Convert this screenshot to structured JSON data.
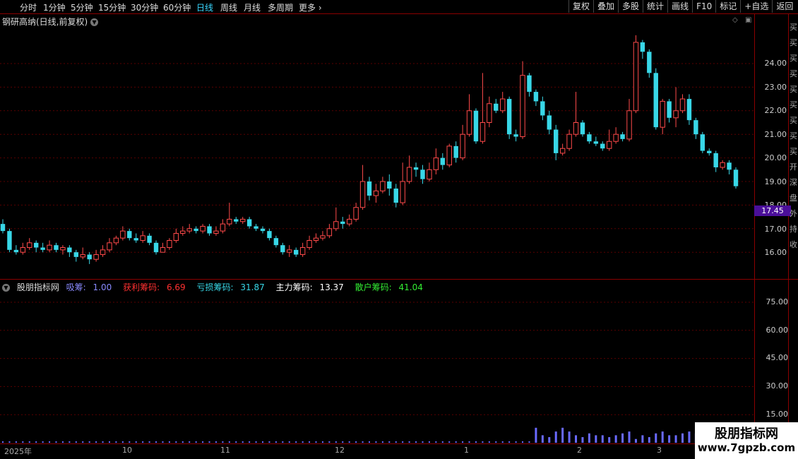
{
  "toolbar": {
    "periods": [
      "分时",
      "1分钟",
      "5分钟",
      "15分钟",
      "30分钟",
      "60分钟",
      "日线",
      "周线",
      "月线",
      "多周期",
      "更多"
    ],
    "active_period": "日线",
    "right_buttons": [
      "复权",
      "叠加",
      "多股",
      "统计",
      "画线",
      "F10",
      "标记",
      "+自选",
      "返回"
    ]
  },
  "main_chart": {
    "title": "钢研高纳(日线,前复权)",
    "price_labels": [
      "24.00",
      "23.00",
      "22.00",
      "21.00",
      "20.00",
      "19.00",
      "18.00",
      "17.00",
      "16.00"
    ],
    "current_price": "17.45",
    "colors": {
      "up": "#ff4a4a",
      "down": "#38d7e7",
      "grid": "#5a0000",
      "current_bg": "#4b0f9a"
    }
  },
  "right_strip_chars": [
    "买",
    "买",
    "买",
    "买",
    "买",
    "买",
    "买",
    "买",
    "买",
    "开",
    "深",
    "盘",
    "外",
    "持",
    "收"
  ],
  "indicator": {
    "name": "股朋指标网",
    "values": [
      {
        "label": "吸筹:",
        "value": "1.00",
        "color": "#8a8aff"
      },
      {
        "label": "获利筹码:",
        "value": "6.69",
        "color": "#ff3030"
      },
      {
        "label": "亏损筹码:",
        "value": "31.87",
        "color": "#38d7e7"
      },
      {
        "label": "主力筹码:",
        "value": "13.37",
        "color": "#ffffff"
      },
      {
        "label": "散户筹码:",
        "value": "41.04",
        "color": "#33ee33"
      }
    ],
    "axis_labels": [
      "75.00",
      "60.00",
      "45.00",
      "30.00",
      "15.00"
    ]
  },
  "xaxis": [
    "2025年",
    "10",
    "11",
    "12",
    "1",
    "2",
    "3"
  ],
  "chart_data": [
    {
      "type": "candlestick",
      "title": "钢研高纳(日线,前复权)",
      "ylim": [
        15.0,
        25.5
      ],
      "candles": [
        [
          17.2,
          16.9,
          17.4,
          16.8
        ],
        [
          16.9,
          16.1,
          17.0,
          16.0
        ],
        [
          16.1,
          16.0,
          16.3,
          15.9
        ],
        [
          16.0,
          16.2,
          16.4,
          15.9
        ],
        [
          16.2,
          16.4,
          16.6,
          16.1
        ],
        [
          16.4,
          16.2,
          16.5,
          16.0
        ],
        [
          16.2,
          16.1,
          16.4,
          16.0
        ],
        [
          16.1,
          16.3,
          16.5,
          16.0
        ],
        [
          16.3,
          16.1,
          16.4,
          16.0
        ],
        [
          16.1,
          16.2,
          16.3,
          15.9
        ],
        [
          16.2,
          16.0,
          16.3,
          15.8
        ],
        [
          16.0,
          15.8,
          16.1,
          15.6
        ],
        [
          15.8,
          15.9,
          16.2,
          15.7
        ],
        [
          15.9,
          15.7,
          16.0,
          15.5
        ],
        [
          15.7,
          15.9,
          16.1,
          15.6
        ],
        [
          15.9,
          16.1,
          16.3,
          15.8
        ],
        [
          16.1,
          16.4,
          16.6,
          16.0
        ],
        [
          16.4,
          16.6,
          16.7,
          16.3
        ],
        [
          16.6,
          16.9,
          17.1,
          16.5
        ],
        [
          16.9,
          16.6,
          17.0,
          16.5
        ],
        [
          16.6,
          16.5,
          16.8,
          16.4
        ],
        [
          16.5,
          16.7,
          16.9,
          16.4
        ],
        [
          16.7,
          16.4,
          16.8,
          16.3
        ],
        [
          16.4,
          16.0,
          16.5,
          15.9
        ],
        [
          16.0,
          16.2,
          16.4,
          16.0
        ],
        [
          16.2,
          16.5,
          16.6,
          16.1
        ],
        [
          16.5,
          16.8,
          17.0,
          16.4
        ],
        [
          16.8,
          16.9,
          17.1,
          16.7
        ],
        [
          16.9,
          17.0,
          17.2,
          16.8
        ],
        [
          17.0,
          16.9,
          17.1,
          16.8
        ],
        [
          16.9,
          17.1,
          17.2,
          16.8
        ],
        [
          17.1,
          16.8,
          17.2,
          16.7
        ],
        [
          16.8,
          16.9,
          17.1,
          16.7
        ],
        [
          16.9,
          17.2,
          17.4,
          16.8
        ],
        [
          17.2,
          17.4,
          18.1,
          17.1
        ],
        [
          17.4,
          17.3,
          17.5,
          17.2
        ],
        [
          17.3,
          17.4,
          17.5,
          17.2
        ],
        [
          17.4,
          17.1,
          17.5,
          17.0
        ],
        [
          17.1,
          17.0,
          17.2,
          16.9
        ],
        [
          17.0,
          16.9,
          17.1,
          16.8
        ],
        [
          16.9,
          16.6,
          17.0,
          16.5
        ],
        [
          16.6,
          16.3,
          16.7,
          16.2
        ],
        [
          16.3,
          16.0,
          16.4,
          15.9
        ],
        [
          16.0,
          16.1,
          16.3,
          15.8
        ],
        [
          16.1,
          15.9,
          16.2,
          15.8
        ],
        [
          15.9,
          16.2,
          16.4,
          15.8
        ],
        [
          16.2,
          16.5,
          16.7,
          16.1
        ],
        [
          16.5,
          16.6,
          16.8,
          16.4
        ],
        [
          16.6,
          16.7,
          16.9,
          16.5
        ],
        [
          16.7,
          17.0,
          17.2,
          16.6
        ],
        [
          17.0,
          17.3,
          17.9,
          16.9
        ],
        [
          17.3,
          17.2,
          17.5,
          17.0
        ],
        [
          17.2,
          17.4,
          17.6,
          17.1
        ],
        [
          17.4,
          17.9,
          18.1,
          17.3
        ],
        [
          17.9,
          19.0,
          19.7,
          17.8
        ],
        [
          19.0,
          18.4,
          19.2,
          18.2
        ],
        [
          18.4,
          18.6,
          18.9,
          18.1
        ],
        [
          18.6,
          19.0,
          19.2,
          18.5
        ],
        [
          19.0,
          18.7,
          19.3,
          18.4
        ],
        [
          18.7,
          18.1,
          18.9,
          17.9
        ],
        [
          18.1,
          19.0,
          19.8,
          18.0
        ],
        [
          19.0,
          19.6,
          20.1,
          18.9
        ],
        [
          19.6,
          19.5,
          19.8,
          19.2
        ],
        [
          19.5,
          19.1,
          19.7,
          18.9
        ],
        [
          19.1,
          19.5,
          19.8,
          19.0
        ],
        [
          19.5,
          20.0,
          20.4,
          19.3
        ],
        [
          20.0,
          19.7,
          20.2,
          19.5
        ],
        [
          19.7,
          20.5,
          20.6,
          19.6
        ],
        [
          20.5,
          20.0,
          20.7,
          19.8
        ],
        [
          20.0,
          21.0,
          21.4,
          19.9
        ],
        [
          21.0,
          22.0,
          22.7,
          20.9
        ],
        [
          22.0,
          20.7,
          22.1,
          20.6
        ],
        [
          20.7,
          21.5,
          23.6,
          20.6
        ],
        [
          21.5,
          22.3,
          22.6,
          21.3
        ],
        [
          22.3,
          22.0,
          22.5,
          21.9
        ],
        [
          22.0,
          22.5,
          22.8,
          21.9
        ],
        [
          22.5,
          21.0,
          22.6,
          20.8
        ],
        [
          21.0,
          20.9,
          21.2,
          20.7
        ],
        [
          20.9,
          23.5,
          24.1,
          20.8
        ],
        [
          23.5,
          22.8,
          23.6,
          22.6
        ],
        [
          22.8,
          22.4,
          22.9,
          22.2
        ],
        [
          22.4,
          21.8,
          22.6,
          21.6
        ],
        [
          21.8,
          21.2,
          22.0,
          21.0
        ],
        [
          21.2,
          20.2,
          21.4,
          19.9
        ],
        [
          20.2,
          20.4,
          20.6,
          20.1
        ],
        [
          20.4,
          21.0,
          21.2,
          20.3
        ],
        [
          21.0,
          21.5,
          22.8,
          20.9
        ],
        [
          21.5,
          21.0,
          21.6,
          20.9
        ],
        [
          21.0,
          20.7,
          21.1,
          20.6
        ],
        [
          20.7,
          20.6,
          20.9,
          20.5
        ],
        [
          20.6,
          20.4,
          20.7,
          20.3
        ],
        [
          20.4,
          20.7,
          21.2,
          20.3
        ],
        [
          20.7,
          21.0,
          21.3,
          20.6
        ],
        [
          21.0,
          20.8,
          21.1,
          20.7
        ],
        [
          20.8,
          22.0,
          22.5,
          20.7
        ],
        [
          22.0,
          24.9,
          25.2,
          21.9
        ],
        [
          24.9,
          24.5,
          25.0,
          24.2
        ],
        [
          24.5,
          23.6,
          24.6,
          23.4
        ],
        [
          23.6,
          21.3,
          23.8,
          21.2
        ],
        [
          21.3,
          22.4,
          22.5,
          21.0
        ],
        [
          22.4,
          21.7,
          22.5,
          21.5
        ],
        [
          21.7,
          22.0,
          23.0,
          21.3
        ],
        [
          22.0,
          22.5,
          22.7,
          21.9
        ],
        [
          22.5,
          21.6,
          22.7,
          21.4
        ],
        [
          21.6,
          21.0,
          21.7,
          20.8
        ],
        [
          21.0,
          20.3,
          21.1,
          20.2
        ],
        [
          20.3,
          20.2,
          20.4,
          20.1
        ],
        [
          20.2,
          19.6,
          20.3,
          19.4
        ],
        [
          19.6,
          19.8,
          19.9,
          19.5
        ],
        [
          19.8,
          19.5,
          19.9,
          19.3
        ],
        [
          19.5,
          18.8,
          19.6,
          18.7
        ]
      ]
    },
    {
      "type": "bar",
      "title": "股朋指标网",
      "ylim": [
        0,
        85
      ],
      "series": [
        {
          "name": "吸筹",
          "values": [
            0,
            0,
            0,
            0,
            0,
            0,
            0,
            0,
            0,
            0,
            0,
            0,
            0,
            0,
            0,
            0,
            0,
            0,
            0,
            0,
            0,
            0,
            0,
            0,
            0,
            0,
            0,
            0,
            0,
            0,
            0,
            0,
            0,
            0,
            0,
            0,
            0,
            0,
            0,
            0,
            0,
            0,
            0,
            0,
            0,
            0,
            0,
            0,
            0,
            0,
            0,
            0,
            0,
            0,
            0,
            0,
            0,
            0,
            0,
            0,
            0,
            0,
            0,
            0,
            0,
            0,
            0,
            0,
            0,
            0,
            0,
            0,
            0,
            0,
            0,
            0,
            0,
            0,
            0,
            0,
            8,
            4,
            3,
            6,
            8,
            6,
            4,
            3,
            5,
            4,
            4,
            3,
            4,
            5,
            6,
            2,
            4,
            3,
            5,
            6,
            4,
            4,
            5,
            6,
            5,
            0,
            0,
            0,
            0,
            0,
            0,
            0,
            0
          ]
        }
      ]
    }
  ]
}
